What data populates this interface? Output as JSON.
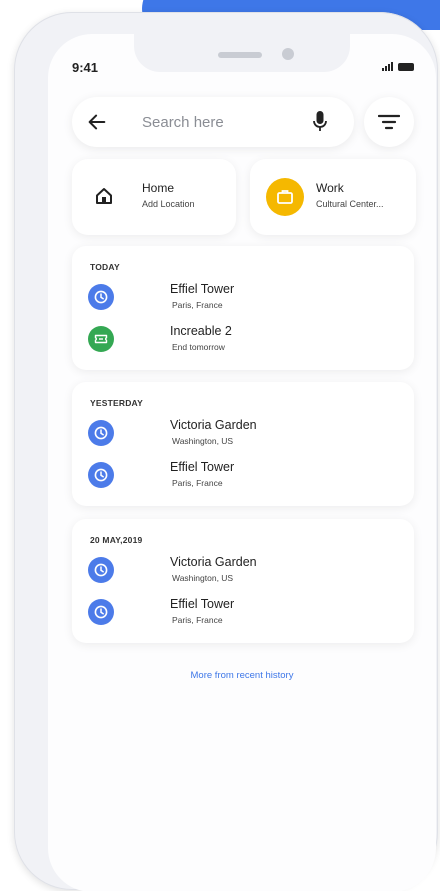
{
  "status_bar": {
    "time": "9:41"
  },
  "search": {
    "placeholder": "Search here"
  },
  "shortcuts": [
    {
      "title": "Home",
      "subtitle": "Add Location"
    },
    {
      "title": "Work",
      "subtitle": "Cultural Center..."
    }
  ],
  "history": [
    {
      "heading": "TODAY",
      "items": [
        {
          "title": "Effiel Tower",
          "subtitle": "Paris, France",
          "icon": "clock-icon"
        },
        {
          "title": "Increable 2",
          "subtitle": "End tomorrow",
          "icon": "ticket-icon"
        }
      ]
    },
    {
      "heading": "YESTERDAY",
      "items": [
        {
          "title": "Victoria Garden",
          "subtitle": "Washington, US",
          "icon": "clock-icon"
        },
        {
          "title": "Effiel Tower",
          "subtitle": "Paris, France",
          "icon": "clock-icon"
        }
      ]
    },
    {
      "heading": "20 MAY,2019",
      "items": [
        {
          "title": "Victoria Garden",
          "subtitle": "Washington, US",
          "icon": "clock-icon"
        },
        {
          "title": "Effiel Tower",
          "subtitle": "Paris, France",
          "icon": "clock-icon"
        }
      ]
    }
  ],
  "more_link": "More from recent history",
  "colors": {
    "accent": "#3e77e8",
    "clock_icon_bg": "#4c7be9",
    "ticket_icon_bg": "#34a853",
    "work_icon_bg": "#f5b800"
  }
}
